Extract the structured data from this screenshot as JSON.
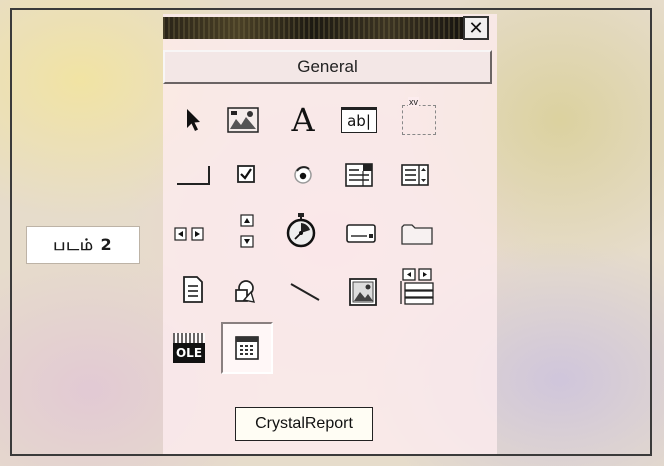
{
  "figure_label": "படம் 2",
  "toolbox": {
    "close_symbol": "✕",
    "tab_label": "General",
    "tools": [
      {
        "name": "pointer-icon"
      },
      {
        "name": "picturebox-icon"
      },
      {
        "name": "label-icon",
        "text": "A"
      },
      {
        "name": "textbox-icon",
        "text": "ab|"
      },
      {
        "name": "frame-icon",
        "text": "xv"
      },
      {
        "name": "commandbutton-icon"
      },
      {
        "name": "checkbox-icon"
      },
      {
        "name": "optionbutton-icon"
      },
      {
        "name": "combobox-icon"
      },
      {
        "name": "listbox-icon"
      },
      {
        "name": "hscrollbar-icon"
      },
      {
        "name": "vscrollbar-icon"
      },
      {
        "name": "timer-icon"
      },
      {
        "name": "drivelistbox-icon"
      },
      {
        "name": "dirlistbox-icon"
      },
      {
        "name": "filelistbox-icon"
      },
      {
        "name": "shape-icon"
      },
      {
        "name": "line-icon"
      },
      {
        "name": "image-icon"
      },
      {
        "name": "data-icon"
      },
      {
        "name": "ole-icon",
        "text": "OLE"
      },
      {
        "name": "crystalreport-icon",
        "selected": true
      }
    ],
    "tooltip": "CrystalReport"
  }
}
